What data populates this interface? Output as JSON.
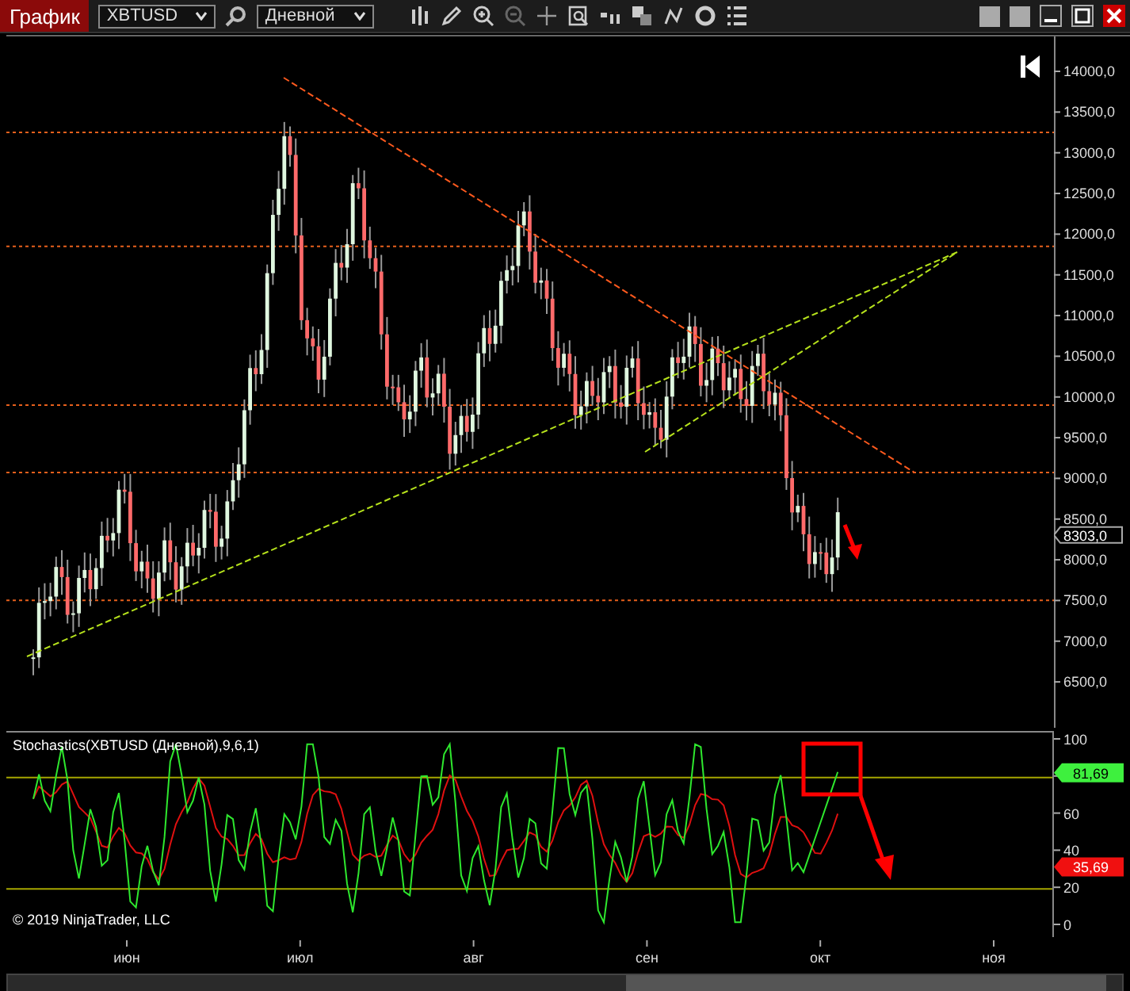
{
  "toolbar": {
    "tab": "График",
    "instrument": "XBTUSD",
    "interval": "Дневной"
  },
  "price_panel": {
    "ticks": [
      "14000,0",
      "13500,0",
      "13000,0",
      "12500,0",
      "12000,0",
      "11500,0",
      "11000,0",
      "10500,0",
      "10000,0",
      "9500,0",
      "9000,0",
      "8500,0",
      "8000,0",
      "7500,0",
      "7000,0",
      "6500,0"
    ],
    "current_price": "8303,0"
  },
  "stochastic_panel": {
    "title": "Stochastics(XBTUSD (Дневной),9,6,1)",
    "ticks": [
      "100",
      "60",
      "40",
      "20",
      "0"
    ],
    "k_value": "81,69",
    "d_value": "35,69",
    "copyright": "© 2019 NinjaTrader, LLC"
  },
  "time_axis": {
    "labels": [
      "июн",
      "июл",
      "авг",
      "сен",
      "окт",
      "ноя"
    ]
  }
}
